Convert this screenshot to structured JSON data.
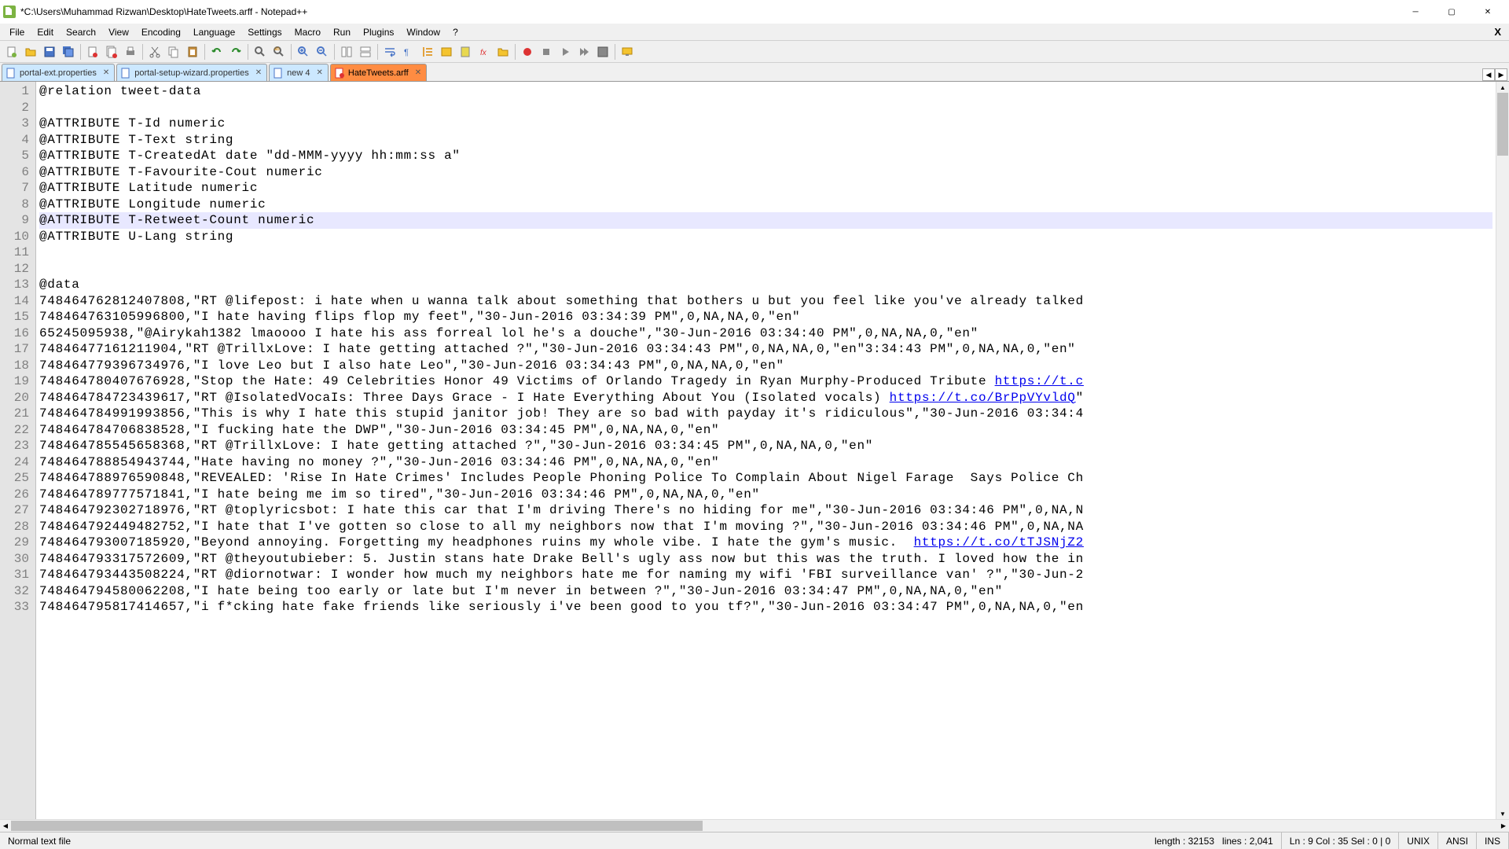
{
  "window": {
    "title": "*C:\\Users\\Muhammad Rizwan\\Desktop\\HateTweets.arff - Notepad++"
  },
  "menu": {
    "items": [
      "File",
      "Edit",
      "Search",
      "View",
      "Encoding",
      "Language",
      "Settings",
      "Macro",
      "Run",
      "Plugins",
      "Window",
      "?"
    ],
    "close_doc": "X"
  },
  "tabs": [
    {
      "label": "portal-ext.properties",
      "active": false,
      "blue": true
    },
    {
      "label": "portal-setup-wizard.properties",
      "active": false,
      "blue": true
    },
    {
      "label": "new 4",
      "active": false,
      "blue": true
    },
    {
      "label": "HateTweets.arff",
      "active": true,
      "blue": false
    }
  ],
  "editor": {
    "current_line": 9,
    "lines": [
      "@relation tweet-data",
      "",
      "@ATTRIBUTE T-Id numeric",
      "@ATTRIBUTE T-Text string",
      "@ATTRIBUTE T-CreatedAt date \"dd-MMM-yyyy hh:mm:ss a\"",
      "@ATTRIBUTE T-Favourite-Cout numeric",
      "@ATTRIBUTE Latitude numeric",
      "@ATTRIBUTE Longitude numeric",
      "@ATTRIBUTE T-Retweet-Count numeric",
      "@ATTRIBUTE U-Lang string",
      "",
      "",
      "@data",
      "748464762812407808,\"RT @lifepost: i hate when u wanna talk about something that bothers u but you feel like you've already talked",
      "748464763105996800,\"I hate having flips flop my feet\",\"30-Jun-2016 03:34:39 PM\",0,NA,NA,0,\"en\"",
      "65245095938,\"@Airykah1382 lmaoooo I hate his ass forreal lol he's a douche\",\"30-Jun-2016 03:34:40 PM\",0,NA,NA,0,\"en\"",
      "74846477161211904,\"RT @TrillxLove: I hate getting attached ?\",\"30-Jun-2016 03:34:43 PM\",0,NA,NA,0,\"en\"3:34:43 PM\",0,NA,NA,0,\"en\"",
      "748464779396734976,\"I love Leo but I also hate Leo\",\"30-Jun-2016 03:34:43 PM\",0,NA,NA,0,\"en\"",
      "748464780407676928,\"Stop the Hate: 49 Celebrities Honor 49 Victims of Orlando Tragedy in Ryan Murphy-Produced Tribute https://t.c",
      "748464784723439617,\"RT @IsolatedVocaIs: Three Days Grace - I Hate Everything About You (Isolated vocals) https://t.co/BrPpVYvldQ\"",
      "748464784991993856,\"This is why I hate this stupid janitor job! They are so bad with payday it's ridiculous\",\"30-Jun-2016 03:34:4",
      "748464784706838528,\"I fucking hate the DWP\",\"30-Jun-2016 03:34:45 PM\",0,NA,NA,0,\"en\"",
      "748464785545658368,\"RT @TrillxLove: I hate getting attached ?\",\"30-Jun-2016 03:34:45 PM\",0,NA,NA,0,\"en\"",
      "748464788854943744,\"Hate having no money ?\",\"30-Jun-2016 03:34:46 PM\",0,NA,NA,0,\"en\"",
      "748464788976590848,\"REVEALED: 'Rise In Hate Crimes' Includes People Phoning Police To Complain About Nigel Farage  Says Police Ch",
      "748464789777571841,\"I hate being me im so tired\",\"30-Jun-2016 03:34:46 PM\",0,NA,NA,0,\"en\"",
      "748464792302718976,\"RT @toplyricsbot: I hate this car that I'm driving There's no hiding for me\",\"30-Jun-2016 03:34:46 PM\",0,NA,N",
      "748464792449482752,\"I hate that I've gotten so close to all my neighbors now that I'm moving ?\",\"30-Jun-2016 03:34:46 PM\",0,NA,NA",
      "748464793007185920,\"Beyond annoying. Forgetting my headphones ruins my whole vibe. I hate the gym's music.  https://t.co/tTJSNjZ2",
      "748464793317572609,\"RT @theyoutubieber: 5. Justin stans hate Drake Bell's ugly ass now but this was the truth. I loved how the in",
      "748464793443508224,\"RT @diornotwar: I wonder how much my neighbors hate me for naming my wifi 'FBI surveillance van' ?\",\"30-Jun-2",
      "748464794580062208,\"I hate being too early or late but I'm never in between ?\",\"30-Jun-2016 03:34:47 PM\",0,NA,NA,0,\"en\"",
      "748464795817414657,\"i f*cking hate fake friends like seriously i've been good to you tf?\",\"30-Jun-2016 03:34:47 PM\",0,NA,NA,0,\"en"
    ],
    "links": {
      "19": "https://t.c",
      "20": "https://t.co/BrPpVYvldQ",
      "29": "https://t.co/tTJSNjZ2"
    }
  },
  "status": {
    "file_type": "Normal text file",
    "length": "length : 32153",
    "lines": "lines : 2,041",
    "position": "Ln : 9    Col : 35    Sel : 0 | 0",
    "eol": "UNIX",
    "encoding": "ANSI",
    "mode": "INS"
  }
}
